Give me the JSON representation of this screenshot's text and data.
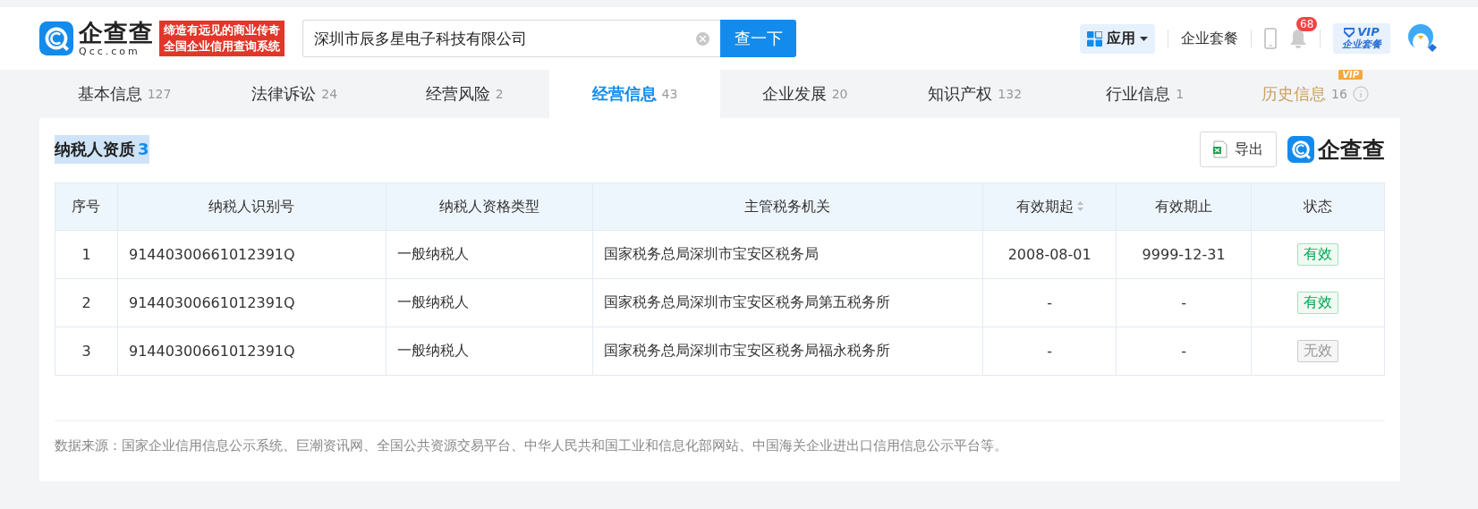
{
  "header": {
    "logo": {
      "name": "企查查",
      "domain": "Qcc.com"
    },
    "slogan": [
      "缔造有远见的商业传奇",
      "全国企业信用查询系统"
    ],
    "search": {
      "value": "深圳市辰多星电子科技有限公司",
      "button": "查一下"
    },
    "nav": {
      "apps": "应用",
      "package": "企业套餐",
      "notifications": "68",
      "vip": {
        "title": "VIP",
        "subtitle": "企业套餐"
      }
    }
  },
  "tabs": [
    {
      "label": "基本信息",
      "count": "127",
      "selected": false,
      "vip": false
    },
    {
      "label": "法律诉讼",
      "count": "24",
      "selected": false,
      "vip": false
    },
    {
      "label": "经营风险",
      "count": "2",
      "selected": false,
      "vip": false
    },
    {
      "label": "经营信息",
      "count": "43",
      "selected": true,
      "vip": false
    },
    {
      "label": "企业发展",
      "count": "20",
      "selected": false,
      "vip": false
    },
    {
      "label": "知识产权",
      "count": "132",
      "selected": false,
      "vip": false
    },
    {
      "label": "行业信息",
      "count": "1",
      "selected": false,
      "vip": false
    },
    {
      "label": "历史信息",
      "count": "16",
      "selected": false,
      "vip": true,
      "vip_badge": "VIP"
    }
  ],
  "section": {
    "title": "纳税人资质",
    "count": "3",
    "export": "导出",
    "brand": "企查查"
  },
  "table": {
    "columns": [
      {
        "label": "序号",
        "sortable": false
      },
      {
        "label": "纳税人识别号",
        "sortable": false
      },
      {
        "label": "纳税人资格类型",
        "sortable": false
      },
      {
        "label": "主管税务机关",
        "sortable": false
      },
      {
        "label": "有效期起",
        "sortable": true
      },
      {
        "label": "有效期止",
        "sortable": false
      },
      {
        "label": "状态",
        "sortable": false
      }
    ],
    "rows": [
      {
        "no": "1",
        "tax_id": "91440300661012391Q",
        "type": "一般纳税人",
        "authority": "国家税务总局深圳市宝安区税务局",
        "start": "2008-08-01",
        "end": "9999-12-31",
        "status": "有效",
        "active": true
      },
      {
        "no": "2",
        "tax_id": "91440300661012391Q",
        "type": "一般纳税人",
        "authority": "国家税务总局深圳市宝安区税务局第五税务所",
        "start": "-",
        "end": "-",
        "status": "有效",
        "active": true
      },
      {
        "no": "3",
        "tax_id": "91440300661012391Q",
        "type": "一般纳税人",
        "authority": "国家税务总局深圳市宝安区税务局福永税务所",
        "start": "-",
        "end": "-",
        "status": "无效",
        "active": false
      }
    ]
  },
  "source_note": "数据来源：国家企业信用信息公示系统、巨潮资讯网、全国公共资源交易平台、中华人民共和国工业和信息化部网站、中国海关企业进出口信用信息公示平台等。"
}
